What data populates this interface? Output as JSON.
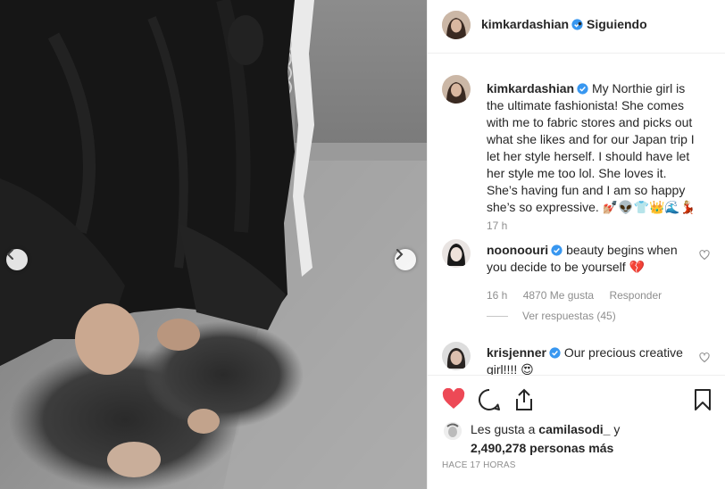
{
  "post": {
    "username": "kimkardashian",
    "separator": "•",
    "follow_status": "Siguiendo",
    "caption_text": "My Northie girl is the ultimate fashionista! She comes with me to fabric stores and picks out what she likes and for our Japan trip I let her style herself. I should have let her style me too lol. She loves it. She’s having fun and I am so happy she’s so expressive. 💅🏼👽👕👑🌊💃🏼",
    "caption_time": "17 h"
  },
  "comments": [
    {
      "username": "noonoouri",
      "text": "beauty begins when you decide to be yourself 💔",
      "time": "16 h",
      "likes": "4870 Me gusta",
      "reply_label": "Responder",
      "view_replies": "Ver respuestas (45)"
    },
    {
      "username": "krisjenner",
      "text": "Our precious creative girl!!!! 😍"
    }
  ],
  "likes": {
    "prefix": "Les gusta a",
    "user": "camilasodi_",
    "joiner": "y",
    "count": "2,490,278 personas más"
  },
  "timestamp": "HACE 17 HORAS",
  "icons": {
    "like": "heart-icon",
    "comment": "comment-icon",
    "share": "share-icon",
    "save": "bookmark-icon",
    "prev": "chevron-left-icon",
    "next": "chevron-right-icon",
    "verified": "verified-badge-icon"
  },
  "colors": {
    "like_active": "#ed4956",
    "verified": "#3897f0",
    "secondary_text": "#8e8e8e",
    "border": "#efefef"
  }
}
